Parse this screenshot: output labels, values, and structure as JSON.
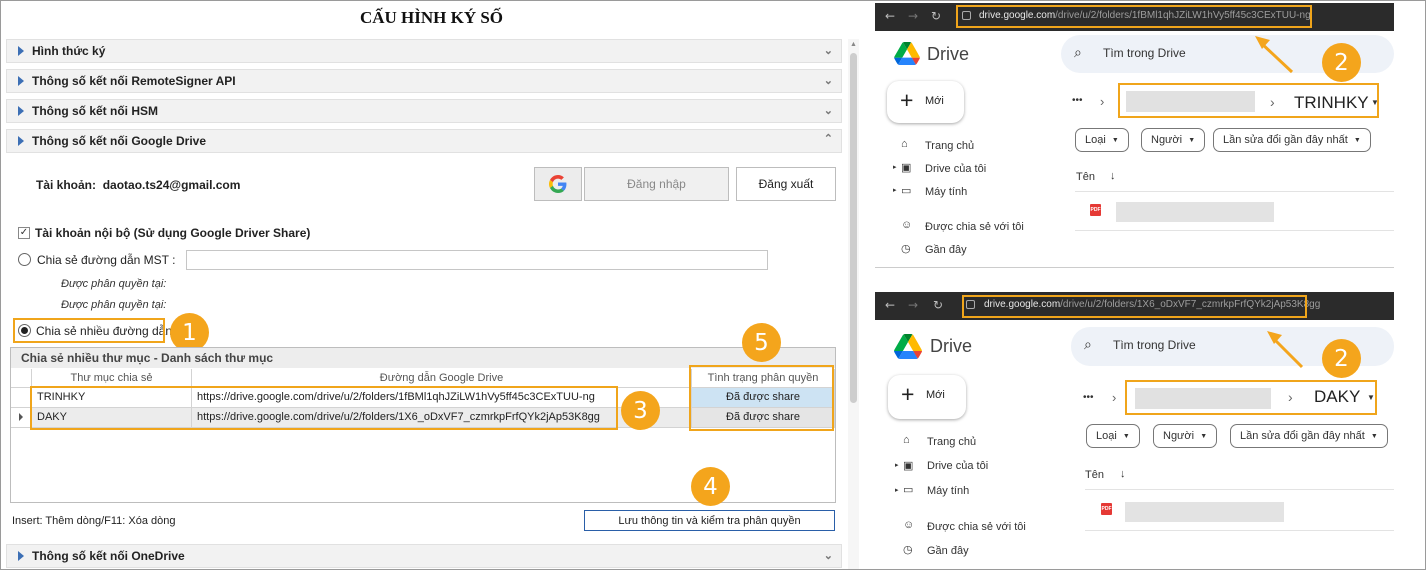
{
  "form": {
    "title": "CẤU HÌNH KÝ SỐ",
    "sections": [
      "Hình thức ký",
      "Thông số kết nối RemoteSigner API",
      "Thông số kết nối HSM",
      "Thông số kết nối Google Drive"
    ],
    "bottom_section": "Thông số kết nối OneDrive",
    "account_label": "Tài khoản:",
    "account_value": "daotao.ts24@gmail.com",
    "login_button": "Đăng nhập",
    "logout_button": "Đăng xuất",
    "internal_account_label": "Tài khoản nội bộ (Sử dụng Google Driver Share)",
    "share_mst_label": "Chia sẻ đường dẫn MST :",
    "perm_label_1": "Được phân quyền tại:",
    "perm_label_2": "Được phân quyền tại:",
    "share_multi_label": "Chia sẻ nhiều đường dẫn :",
    "grid": {
      "title": "Chia sẻ nhiều thư mục - Danh sách thư mục",
      "columns": [
        "Thư mục chia sẻ",
        "Đường dẫn Google Drive",
        "Tình trạng phân quyền"
      ],
      "rows": [
        {
          "folder": "TRINHKY",
          "link": "https://drive.google.com/drive/u/2/folders/1fBMl1qhJZiLW1hVy5ff45c3CExTUU-ng",
          "status": "Đã được share"
        },
        {
          "folder": "DAKY",
          "link": "https://drive.google.com/drive/u/2/folders/1X6_oDxVF7_czmrkpFrfQYk2jAp53K8gg",
          "status": "Đã được share"
        }
      ]
    },
    "hint": "Insert: Thêm dòng/F11: Xóa dòng",
    "save_button": "Lưu thông tin và kiểm tra phân quyền",
    "badges": [
      "1",
      "2",
      "3",
      "4",
      "5"
    ]
  },
  "browsers": [
    {
      "url_host": "drive.google.com",
      "url_path": "/drive/u/2/folders/1fBMl1qhJZiLW1hVy5ff45c3CExTUU-ng",
      "app_name": "Drive",
      "search_placeholder": "Tìm trong Drive",
      "new_button": "Mới",
      "nav": [
        "Trang chủ",
        "Drive của tôi",
        "Máy tính",
        "Được chia sẻ với tôi",
        "Gần đây"
      ],
      "crumb_more": "•••",
      "folder": "TRINHKY",
      "filters": [
        "Loại",
        "Người",
        "Lần sửa đổi gần đây nhất"
      ],
      "column": "Tên",
      "badge": "2"
    },
    {
      "url_host": "drive.google.com",
      "url_path": "/drive/u/2/folders/1X6_oDxVF7_czmrkpFrfQYk2jAp53K8gg",
      "app_name": "Drive",
      "search_placeholder": "Tìm trong Drive",
      "new_button": "Mới",
      "nav": [
        "Trang chủ",
        "Drive của tôi",
        "Máy tính",
        "Được chia sẻ với tôi",
        "Gần đây"
      ],
      "crumb_more": "•••",
      "folder": "DAKY",
      "filters": [
        "Loại",
        "Người",
        "Lần sửa đổi gần đây nhất"
      ],
      "column": "Tên",
      "badge": "2"
    }
  ],
  "colors": {
    "highlight": "#f0a51b",
    "badge": "#f4a51c",
    "grid_status_bg": "#cde3f3"
  }
}
